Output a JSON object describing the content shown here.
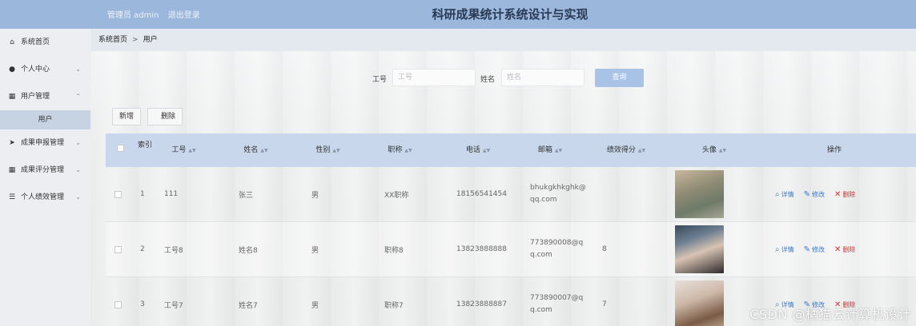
{
  "header": {
    "user_label": "管理员 admin",
    "logout_label": "退出登录",
    "title": "科研成果统计系统设计与实现"
  },
  "sidebar": {
    "items": [
      {
        "label": "系统首页",
        "icon": "home-icon"
      },
      {
        "label": "个人中心",
        "icon": "person-icon"
      },
      {
        "label": "用户管理",
        "icon": "grid-icon"
      },
      {
        "label": "成果申报管理",
        "icon": "send-icon"
      },
      {
        "label": "成果评分管理",
        "icon": "grid-icon"
      },
      {
        "label": "个人绩效管理",
        "icon": "list-icon"
      }
    ],
    "active_sub": "用户"
  },
  "breadcrumb": {
    "home": "系统首页",
    "separator": ">",
    "current": "用户"
  },
  "search": {
    "field1_label": "工号",
    "field1_placeholder": "工号",
    "field2_label": "姓名",
    "field2_placeholder": "姓名",
    "button_label": "查询"
  },
  "toolbar": {
    "add_label": "新增",
    "delete_label": "删除"
  },
  "table": {
    "headers": {
      "index": "索引",
      "job_no": "工号",
      "name": "姓名",
      "gender": "性别",
      "title": "职称",
      "phone": "电话",
      "email": "邮箱",
      "score": "绩效得分",
      "avatar": "头像",
      "ops": "操作"
    },
    "rows": [
      {
        "index": "1",
        "job_no": "111",
        "name": "张三",
        "gender": "男",
        "title": "XX职称",
        "phone": "18156541454",
        "email_l1": "bhukgkhkghk@",
        "email_l2": "qq.com",
        "score": ""
      },
      {
        "index": "2",
        "job_no": "工号8",
        "name": "姓名8",
        "gender": "男",
        "title": "职称8",
        "phone": "13823888888",
        "email_l1": "773890008@q",
        "email_l2": "q.com",
        "score": "8"
      },
      {
        "index": "3",
        "job_no": "工号7",
        "name": "姓名7",
        "gender": "男",
        "title": "职称7",
        "phone": "13823888887",
        "email_l1": "773890007@q",
        "email_l2": "q.com",
        "score": "7"
      }
    ],
    "ops": {
      "detail": "详情",
      "edit": "修改",
      "delete": "删除"
    }
  },
  "watermark": "CSDN @橘猫云计算机设计"
}
